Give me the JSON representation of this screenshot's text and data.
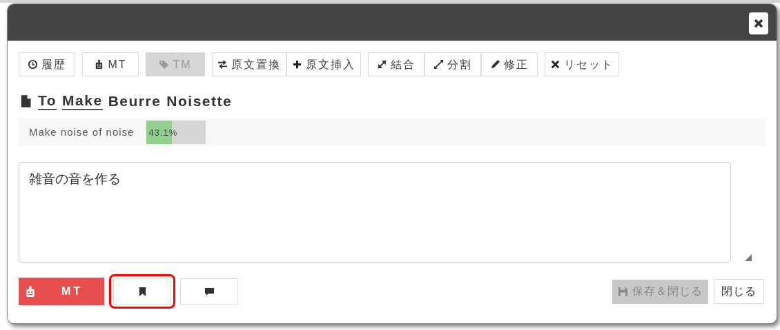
{
  "toolbar": [
    {
      "items": [
        {
          "kind": "clock",
          "label": "履歴",
          "disabled": false
        }
      ]
    },
    {
      "items": [
        {
          "kind": "robot",
          "label": "MT",
          "disabled": false
        }
      ]
    },
    {
      "items": [
        {
          "kind": "tag",
          "label": "TM",
          "disabled": true
        }
      ]
    },
    {
      "items": [
        {
          "kind": "swap",
          "label": "原文置換",
          "disabled": false
        },
        {
          "kind": "plus",
          "label": "原文挿入",
          "disabled": false
        }
      ]
    },
    {
      "items": [
        {
          "kind": "compress",
          "label": "結合",
          "disabled": false
        },
        {
          "kind": "expand",
          "label": "分割",
          "disabled": false
        },
        {
          "kind": "pencil",
          "label": "修正",
          "disabled": false
        }
      ]
    },
    {
      "items": [
        {
          "kind": "x",
          "label": "リセット",
          "disabled": false
        }
      ]
    }
  ],
  "title": {
    "words": [
      {
        "text": "To",
        "underlined": true
      },
      {
        "text": "Make",
        "underlined": true
      },
      {
        "text": "Beurre",
        "underlined": false
      },
      {
        "text": "Noisette",
        "underlined": false
      }
    ]
  },
  "suggestion": {
    "text": "Make noise of noise",
    "match": "43.1%",
    "level": 0.431
  },
  "translation": {
    "value": "雑音の音を作る"
  },
  "footer_left": [
    {
      "kind": "mt",
      "label": "MT",
      "highlighted": false
    },
    {
      "kind": "bookmark",
      "highlighted": true
    },
    {
      "kind": "comment",
      "highlighted": false
    }
  ],
  "footer_right": [
    {
      "label": "保存＆閉じる",
      "kind": "save",
      "disabled": true
    },
    {
      "label": "閉じる",
      "kind": "plain",
      "disabled": false
    }
  ]
}
